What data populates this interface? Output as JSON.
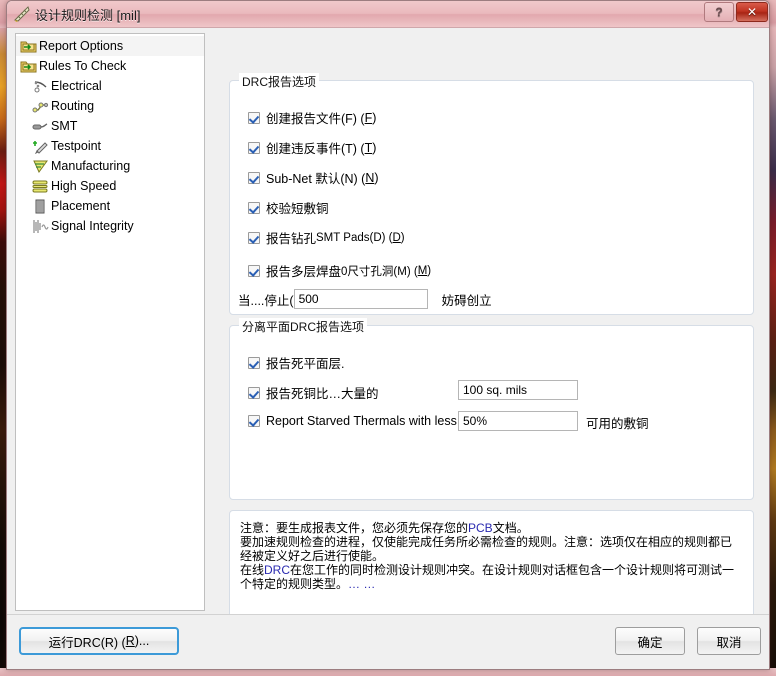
{
  "window": {
    "title": "设计规则检测 [mil]",
    "icon": "ruler-icon",
    "help_label": "?",
    "close_label": "✕"
  },
  "tree": {
    "items": [
      {
        "label": "Report Options",
        "icon": "folder-report-icon",
        "level": 0,
        "selected": true
      },
      {
        "label": "Rules To Check",
        "icon": "folder-rules-icon",
        "level": 0,
        "selected": false
      },
      {
        "label": "Electrical",
        "icon": "electrical-icon",
        "level": 1,
        "selected": false
      },
      {
        "label": "Routing",
        "icon": "routing-icon",
        "level": 1,
        "selected": false
      },
      {
        "label": "SMT",
        "icon": "smt-icon",
        "level": 1,
        "selected": false
      },
      {
        "label": "Testpoint",
        "icon": "testpoint-icon",
        "level": 1,
        "selected": false
      },
      {
        "label": "Manufacturing",
        "icon": "manufacturing-icon",
        "level": 1,
        "selected": false
      },
      {
        "label": "High Speed",
        "icon": "high-speed-icon",
        "level": 1,
        "selected": false
      },
      {
        "label": "Placement",
        "icon": "placement-icon",
        "level": 1,
        "selected": false
      },
      {
        "label": "Signal Integrity",
        "icon": "signal-integrity-icon",
        "level": 1,
        "selected": false
      }
    ]
  },
  "drc_report_options": {
    "legend": "DRC报告选项",
    "create_report_file": {
      "label": "创建报告文件(F) (",
      "mnemonic": "F",
      "suffix": ")",
      "checked": true
    },
    "create_violations": {
      "label": "创建违反事件(T) (",
      "mnemonic": "T",
      "suffix": ")",
      "checked": true
    },
    "sub_net_details": {
      "label": "Sub-Net 默认(N) (",
      "mnemonic": "N",
      "suffix": ")",
      "checked": true
    },
    "verify_shorting": {
      "label": "校验短敷铜",
      "checked": true
    },
    "report_drilled_smt": {
      "label_a": "报告钻孔",
      "label_b": "SMT Pads(D) (",
      "mnemonic": "D",
      "suffix": ")",
      "checked": true
    },
    "report_multilayer": {
      "label_a": "报告多层焊盘",
      "label_b": "0尺寸孔洞(M) (",
      "mnemonic": "M",
      "suffix": ")",
      "checked": true
    },
    "stop_when": {
      "prefix": "当....停止(",
      "value": "500",
      "suffix": "妨碍创立"
    }
  },
  "split_plane_options": {
    "legend": "分离平面DRC报告选项",
    "report_dead_plane": {
      "label": "报告死平面层.",
      "checked": true
    },
    "report_dead_copper": {
      "label": "报告死铜比…大量的",
      "value": "100 sq. mils",
      "checked": true
    },
    "report_starved_thermals": {
      "label": "Report Starved Thermals with less than",
      "value": "50%",
      "suffix": "可用的敷铜",
      "checked": true
    }
  },
  "note": {
    "line1_a": "注意：要生成报表文件，您必须先保存您的",
    "line1_kw": "PCB",
    "line1_b": "文档。",
    "line2": "要加速规则检查的进程，仅使能完成任务所必需检查的规则。注意：选项仅在相应的规则都已经被定义好之后进行使能。",
    "line3_a": "在线",
    "line3_kw": "DRC",
    "line3_b": "在您工作的同时检测设计规则冲突。在设计规则对话框包含一个设计规则将可测试一个特定的规则类型。",
    "line3_tail": "… …"
  },
  "footer": {
    "run_drc": "运行DRC(R) (R)...",
    "run_drc_prefix": "运行DRC(R) (",
    "run_drc_mnemonic": "R",
    "run_drc_suffix": ")...",
    "ok": "确定",
    "cancel": "取消"
  },
  "colors": {
    "title_bar": "#eab9bd",
    "close_button": "#c03422",
    "focus_border": "#3c9ad8",
    "check_mark": "#2a5fb4",
    "group_border": "#d6dde6",
    "keyword": "#2a2ab0"
  }
}
